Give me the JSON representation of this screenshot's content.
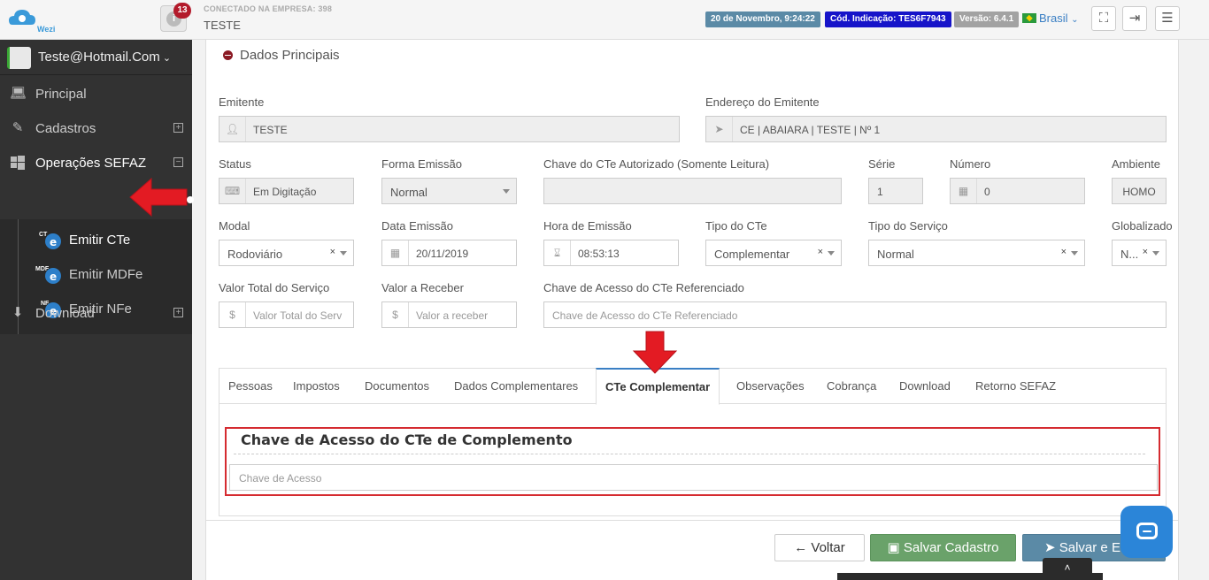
{
  "topbar": {
    "logo_text": "Wezi",
    "notifications": "13",
    "company_label": "CONECTADO NA EMPRESA: 398",
    "company_name": "TESTE",
    "date_badge": "20 de Novembro, 9:24:22",
    "code_badge": "Cód. Indicação: TES6F7943",
    "version_badge": "Versão: 6.4.1",
    "language": "Brasil",
    "colors": {
      "date": "#5b8aa6",
      "code": "#1614c9",
      "version": "#a2a2a2"
    }
  },
  "sidebar": {
    "user": "Teste@Hotmail.Com",
    "items": [
      {
        "label": "Principal",
        "icon": "laptop-icon"
      },
      {
        "label": "Cadastros",
        "icon": "edit-icon"
      },
      {
        "label": "Operações SEFAZ",
        "icon": "windows-icon"
      },
      {
        "label": "Download",
        "icon": "download-icon"
      }
    ],
    "sub_items": [
      {
        "label": "Emitir CTe",
        "icon_text": "CT"
      },
      {
        "label": "Emitir MDFe",
        "icon_text": "MDF"
      },
      {
        "label": "Emitir NFe",
        "icon_text": "NF"
      }
    ]
  },
  "section": {
    "title": "Dados Principais"
  },
  "form": {
    "emitente": {
      "label": "Emitente",
      "value": "TESTE"
    },
    "endereco": {
      "label": "Endereço do Emitente",
      "value": "CE | ABAIARA | TESTE | Nº 1"
    },
    "status": {
      "label": "Status",
      "value": "Em Digitação"
    },
    "forma": {
      "label": "Forma Emissão",
      "value": "Normal"
    },
    "chave_aut": {
      "label": "Chave do CTe Autorizado (Somente Leitura)",
      "value": ""
    },
    "serie": {
      "label": "Série",
      "value": "1"
    },
    "numero": {
      "label": "Número",
      "value": "0"
    },
    "ambiente": {
      "label": "Ambiente",
      "value": "HOMO"
    },
    "modal": {
      "label": "Modal",
      "value": "Rodoviário"
    },
    "data": {
      "label": "Data Emissão",
      "value": "20/11/2019"
    },
    "hora": {
      "label": "Hora de Emissão",
      "value": "08:53:13"
    },
    "tipo_cte": {
      "label": "Tipo do CTe",
      "value": "Complementar"
    },
    "tipo_servico": {
      "label": "Tipo do Serviço",
      "value": "Normal"
    },
    "globalizado": {
      "label": "Globalizado",
      "value": "N..."
    },
    "valor_total": {
      "label": "Valor Total do Serviço",
      "placeholder": "Valor Total do Serv"
    },
    "valor_receber": {
      "label": "Valor a Receber",
      "placeholder": "Valor a receber"
    },
    "chave_ref": {
      "label": "Chave de Acesso do CTe Referenciado",
      "placeholder": "Chave de Acesso do CTe Referenciado"
    },
    "clear_symbol": "×"
  },
  "tabs": [
    "Pessoas",
    "Impostos",
    "Documentos",
    "Dados Complementares",
    "CTe Complementar",
    "Observações",
    "Cobrança",
    "Download",
    "Retorno SEFAZ"
  ],
  "panel": {
    "title": "Chave de Acesso do CTe de Complemento",
    "placeholder": "Chave de Acesso"
  },
  "buttons": {
    "voltar": "Voltar",
    "salvar": "Salvar Cadastro",
    "envio": "Salvar e Env"
  },
  "annotation_color": "#e31b23"
}
